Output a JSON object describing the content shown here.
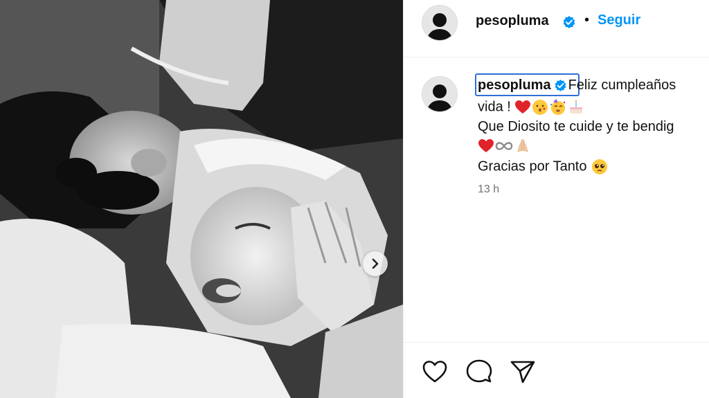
{
  "post": {
    "author": "pesopluma",
    "follow_label": "Seguir",
    "separator": "•",
    "caption": {
      "line1": "Feliz cumpleaños",
      "line2": "vida !",
      "line3": "Que Diosito te cuide y te bendig",
      "line5": "Gracias por Tanto"
    },
    "timestamp": "13 h"
  },
  "icons": {
    "verified": "verified-badge-icon",
    "like": "heart-outline-icon",
    "comment": "comment-bubble-icon",
    "share": "paper-plane-icon",
    "next": "chevron-right-icon"
  },
  "colors": {
    "follow": "#0095f6",
    "verified": "#0095f6",
    "timestamp": "#737373",
    "highlight": "#2f6fd6"
  }
}
